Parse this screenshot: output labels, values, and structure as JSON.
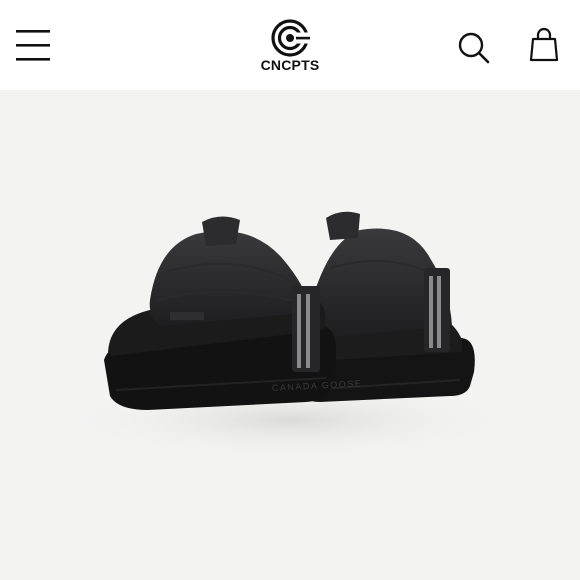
{
  "header": {
    "brand_name": "CNCPTS",
    "menu_icon": "hamburger-menu-icon",
    "search_icon": "search-icon",
    "bag_icon": "shopping-bag-icon"
  },
  "product": {
    "shoe_brand_print": "CANADA GOOSE",
    "background_color": "#f3f3f2"
  },
  "colors": {
    "header_background": "#ffffff",
    "icon_color": "#111111"
  }
}
